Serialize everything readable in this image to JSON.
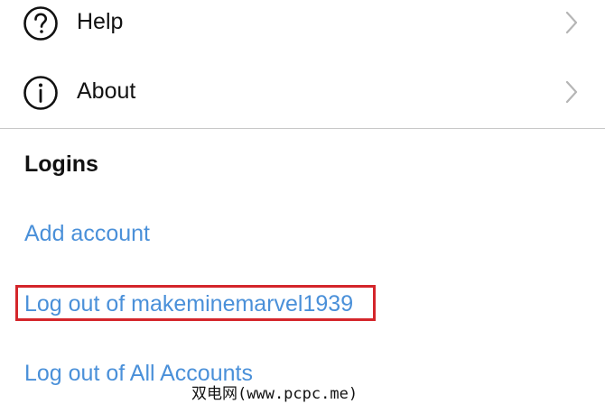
{
  "menu": {
    "items": [
      {
        "label": "Help",
        "icon": "question-circle-icon"
      },
      {
        "label": "About",
        "icon": "info-circle-icon"
      }
    ]
  },
  "logins": {
    "title": "Logins",
    "add_account": "Add account",
    "log_out_user": "Log out of makeminemarvel1939",
    "log_out_all": "Log out of All Accounts"
  },
  "colors": {
    "link": "#4a90d9",
    "highlight": "#d4262b",
    "divider": "#c8c8c8"
  },
  "watermark": "双电网(www.pcpc.me)"
}
